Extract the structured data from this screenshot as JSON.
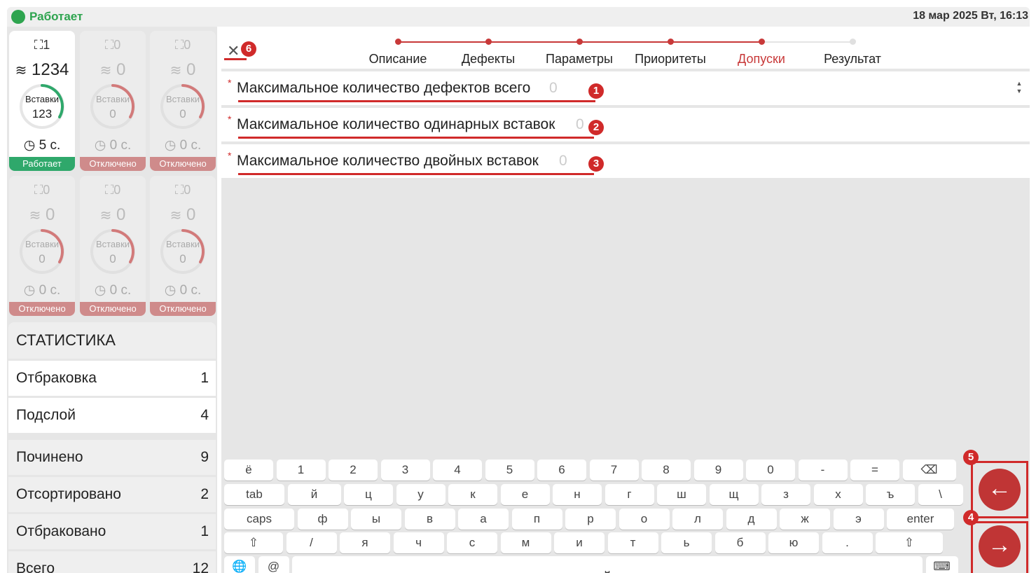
{
  "status": {
    "text": "Работает",
    "datetime": "18 мар 2025 Вт, 16:13",
    "color": "#2ea44f"
  },
  "cards": [
    {
      "count": "1",
      "stack": "1234",
      "ring_label": "Вставки",
      "ring_value": "123",
      "time": "5 с.",
      "state": "Работает",
      "active": true
    },
    {
      "count": "0",
      "stack": "0",
      "ring_label": "Вставки",
      "ring_value": "0",
      "time": "0 с.",
      "state": "Отключено",
      "active": false
    },
    {
      "count": "0",
      "stack": "0",
      "ring_label": "Вставки",
      "ring_value": "0",
      "time": "0 с.",
      "state": "Отключено",
      "active": false
    },
    {
      "count": "0",
      "stack": "0",
      "ring_label": "Вставки",
      "ring_value": "0",
      "time": "0 с.",
      "state": "Отключено",
      "active": false
    },
    {
      "count": "0",
      "stack": "0",
      "ring_label": "Вставки",
      "ring_value": "0",
      "time": "0 с.",
      "state": "Отключено",
      "active": false
    },
    {
      "count": "0",
      "stack": "0",
      "ring_label": "Вставки",
      "ring_value": "0",
      "time": "0 с.",
      "state": "Отключено",
      "active": false
    }
  ],
  "stats": {
    "title": "СТАТИСТИКА",
    "rows": [
      {
        "label": "Отбраковка",
        "value": "1"
      },
      {
        "label": "Подслой",
        "value": "4"
      },
      {
        "label": "Починено",
        "value": "9"
      },
      {
        "label": "Отсортировано",
        "value": "2"
      },
      {
        "label": "Отбраковано",
        "value": "1"
      },
      {
        "label": "Всего",
        "value": "12"
      }
    ]
  },
  "steps": [
    {
      "label": "Описание",
      "state": "done"
    },
    {
      "label": "Дефекты",
      "state": "done"
    },
    {
      "label": "Параметры",
      "state": "done"
    },
    {
      "label": "Приоритеты",
      "state": "done"
    },
    {
      "label": "Допуски",
      "state": "current"
    },
    {
      "label": "Результат",
      "state": "pending"
    }
  ],
  "fields": [
    {
      "label": "Максимальное количество дефектов всего",
      "placeholder": "0",
      "badge": "1"
    },
    {
      "label": "Максимальное количество одинарных вставок",
      "placeholder": "0",
      "badge": "2"
    },
    {
      "label": "Максимальное количество двойных вставок",
      "placeholder": "0",
      "badge": "3"
    }
  ],
  "badges": {
    "close": "6",
    "back": "5",
    "next": "4"
  },
  "icons": {
    "close": "close-icon",
    "back": "arrow-left-icon",
    "next": "arrow-right-icon",
    "globe": "globe-icon",
    "backspace": "backspace-icon",
    "shift": "shift-icon",
    "hide": "keyboard-hide-icon",
    "clock": "clock-icon",
    "layers": "layers-icon",
    "scan": "scan-icon"
  },
  "keyboard": {
    "row1": [
      "ё",
      "1",
      "2",
      "3",
      "4",
      "5",
      "6",
      "7",
      "8",
      "9",
      "0",
      "-",
      "=",
      "⌫"
    ],
    "row2": [
      "tab",
      "й",
      "ц",
      "у",
      "к",
      "е",
      "н",
      "г",
      "ш",
      "щ",
      "з",
      "х",
      "ъ",
      "\\"
    ],
    "row3": [
      "caps",
      "ф",
      "ы",
      "в",
      "а",
      "п",
      "р",
      "о",
      "л",
      "д",
      "ж",
      "э",
      "enter"
    ],
    "row4": [
      "⇧",
      "/",
      "я",
      "ч",
      "с",
      "м",
      "и",
      "т",
      "ь",
      "б",
      "ю",
      ".",
      "⇧"
    ],
    "row5": [
      "🌐",
      "@",
      "⎵",
      "⌨"
    ]
  },
  "colors": {
    "accent": "#c83939",
    "active_green": "#2fa86b",
    "disabled": "#cf8b8b"
  }
}
